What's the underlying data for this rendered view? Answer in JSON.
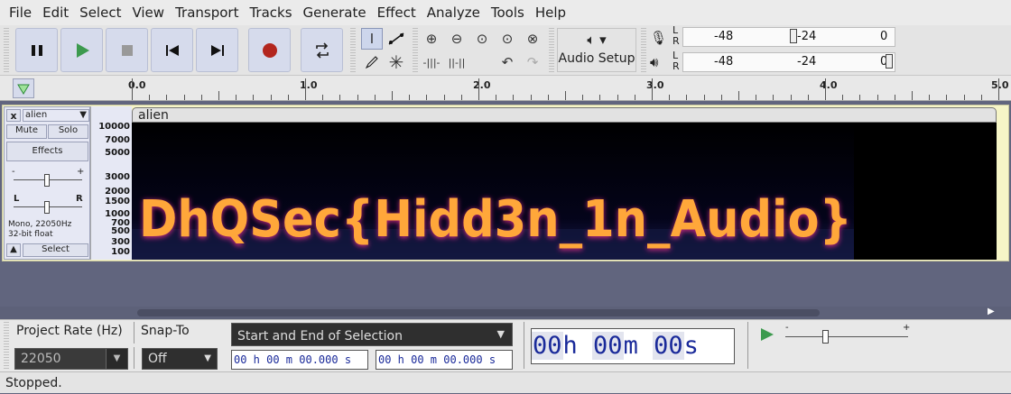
{
  "menu": [
    "File",
    "Edit",
    "Select",
    "View",
    "Transport",
    "Tracks",
    "Generate",
    "Effect",
    "Analyze",
    "Tools",
    "Help"
  ],
  "toolbar": {
    "audio_setup_label": "Audio Setup",
    "meter_record": {
      "ticks": [
        "-48",
        "-24",
        "0"
      ],
      "lr": [
        "L",
        "R"
      ]
    },
    "meter_play": {
      "ticks": [
        "-48",
        "-24",
        "0"
      ],
      "lr": [
        "L",
        "R"
      ]
    }
  },
  "ruler": {
    "ticks": [
      "0.0",
      "1.0",
      "2.0",
      "3.0",
      "4.0",
      "5.0"
    ]
  },
  "track": {
    "name": "alien",
    "mute_label": "Mute",
    "solo_label": "Solo",
    "effects_label": "Effects",
    "gain_minus": "-",
    "gain_plus": "+",
    "pan_left": "L",
    "pan_right": "R",
    "info_line1": "Mono, 22050Hz",
    "info_line2": "32-bit float",
    "select_label": "Select",
    "close_label": "x",
    "clip_name": "alien",
    "scale": [
      "10000",
      "7000",
      "5000",
      "3000",
      "2000",
      "1500",
      "1000",
      "700",
      "500",
      "300",
      "100"
    ],
    "spectrogram_text": "DhQSec{Hidd3n_1n_Audio}"
  },
  "selection_bar": {
    "project_rate_label": "Project Rate (Hz)",
    "snap_to_label": "Snap-To",
    "project_rate_value": "22050",
    "snap_to_value": "Off",
    "selection_mode": "Start and End of Selection",
    "start_time": "00 h 00 m 00.000 s",
    "end_time": "00 h 00 m 00.000 s",
    "big_time": {
      "h": "00",
      "h_unit": "h",
      "m": "00",
      "m_unit": "m",
      "s": "00",
      "s_unit": "s"
    },
    "play_speed_minus": "-",
    "play_speed_plus": "+"
  },
  "status": "Stopped.",
  "colors": {
    "accent": "#2e8b3a",
    "record": "#b3261e",
    "spectro_hot": "#ffb040",
    "spectro_mid": "#c02880"
  }
}
